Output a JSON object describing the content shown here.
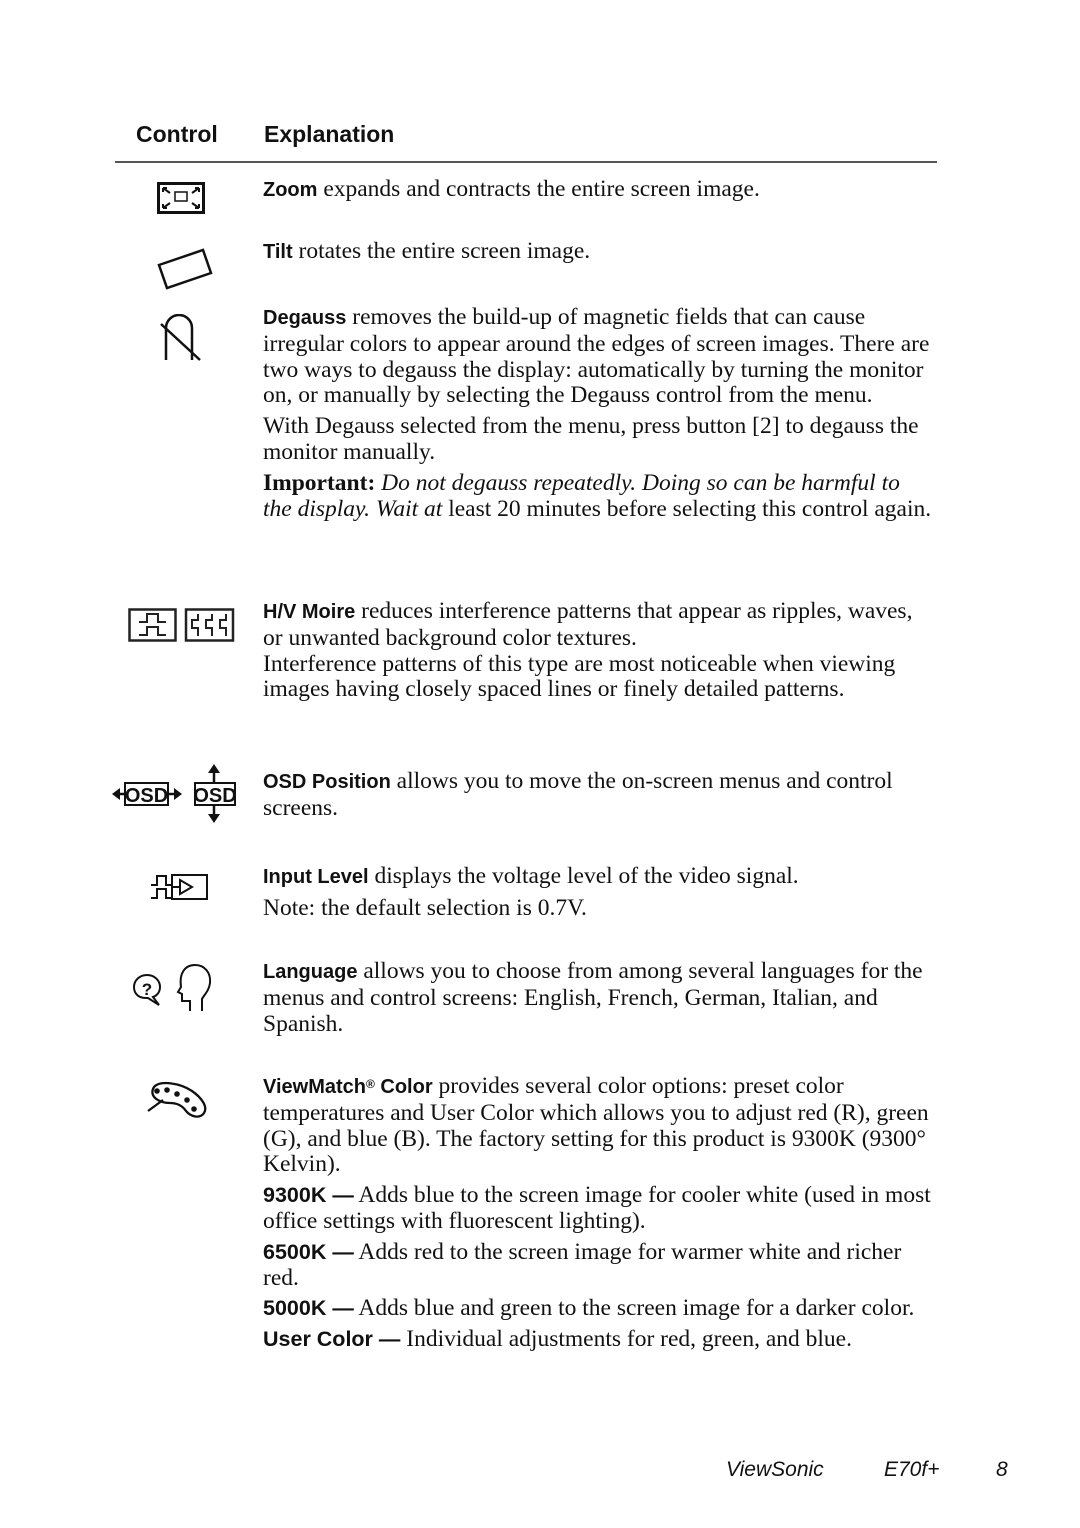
{
  "header": {
    "control_label": "Control",
    "explanation_label": "Explanation"
  },
  "entries": [
    {
      "icon": "zoom-icon",
      "name": "Zoom",
      "text": " expands and contracts the entire screen image."
    },
    {
      "icon": "tilt-icon",
      "name": "Tilt",
      "text": " rotates the entire screen image."
    },
    {
      "icon": "degauss-icon",
      "name": "Degauss",
      "text": " removes the build-up of magnetic fields that can cause irregular colors to appear around the edges of screen images. There are two ways to degauss the display: automatically by turning the monitor on, or manually by selecting the Degauss control from the menu.",
      "para2": "With Degauss selected from the menu, press button [2] to degauss the monitor manually.",
      "important_label": "Important:",
      "important_italic": " Do not degauss repeatedly. Doing so can be harmful to the display. Wait at",
      "important_rest": " least 20 minutes before selecting this control again."
    },
    {
      "icon": "hv-moire-icon",
      "name": "H/V Moire",
      "text": " reduces interference patterns that appear as ripples, waves, or unwanted background color textures.",
      "para2": "Interference patterns of this type are most noticeable when viewing images having closely spaced lines or finely detailed patterns."
    },
    {
      "icon": "osd-position-icon",
      "name": "OSD Position",
      "text": " allows you to move the on-screen menus and control screens.",
      "icon_text": "OSD"
    },
    {
      "icon": "input-level-icon",
      "name": "Input Level",
      "text": " displays the voltage level of the video signal.",
      "para2": "Note: the default selection is 0.7V."
    },
    {
      "icon": "language-icon",
      "name": "Language",
      "text": " allows you to choose from among several languages for the menus and control screens: English, French, German, Italian, and Spanish."
    },
    {
      "icon": "palette-icon",
      "name": "ViewMatch",
      "name_sup": "®",
      "name_suffix": " Color",
      "text": " provides several color options: preset color temperatures and User Color which allows you to adjust red (R), green (G), and blue (B). The factory setting for this product is 9300K (9300° Kelvin).",
      "options": [
        {
          "label": "9300K —",
          "text": " Adds blue to the screen image for cooler white (used in most office settings with fluorescent lighting)."
        },
        {
          "label": "6500K —",
          "text": " Adds red to the screen image for warmer white and richer red."
        },
        {
          "label": "5000K —",
          "text": " Adds blue and green to the screen image for a darker color."
        },
        {
          "label": "User Color —",
          "text": " Individual adjustments for red, green, and blue."
        }
      ]
    }
  ],
  "footer": {
    "brand": "ViewSonic",
    "model": "E70f+",
    "page": "8"
  }
}
